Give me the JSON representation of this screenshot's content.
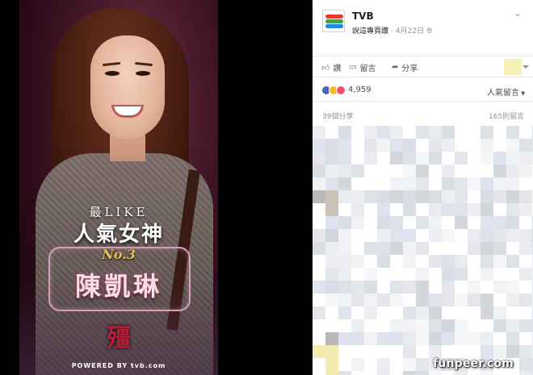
{
  "poster": {
    "line1": "最LIKE",
    "line2": "人氣女神",
    "rank": "No.3",
    "name": "陳凱琳",
    "logo": "殭",
    "powered_by": "POWERED BY tvb.com"
  },
  "post": {
    "page_name": "TVB",
    "author": "說這專頁讚",
    "date": "4月22日",
    "globe_icon": "globe-icon",
    "more_icon": "chevron-down-icon"
  },
  "actions": {
    "like_label": "讚",
    "comment_label": "留言",
    "share_label": "分享"
  },
  "reactions": {
    "count": "4,959",
    "sort_label": "人氣留言"
  },
  "stats": {
    "shares": "39個分享",
    "comments": "165則留言"
  },
  "watermark": "funpeer.com",
  "colors": {
    "fb_blue": "#4267b2",
    "haha_yellow": "#f7b928",
    "love_red": "#f25268",
    "text_gray": "#90949c"
  }
}
